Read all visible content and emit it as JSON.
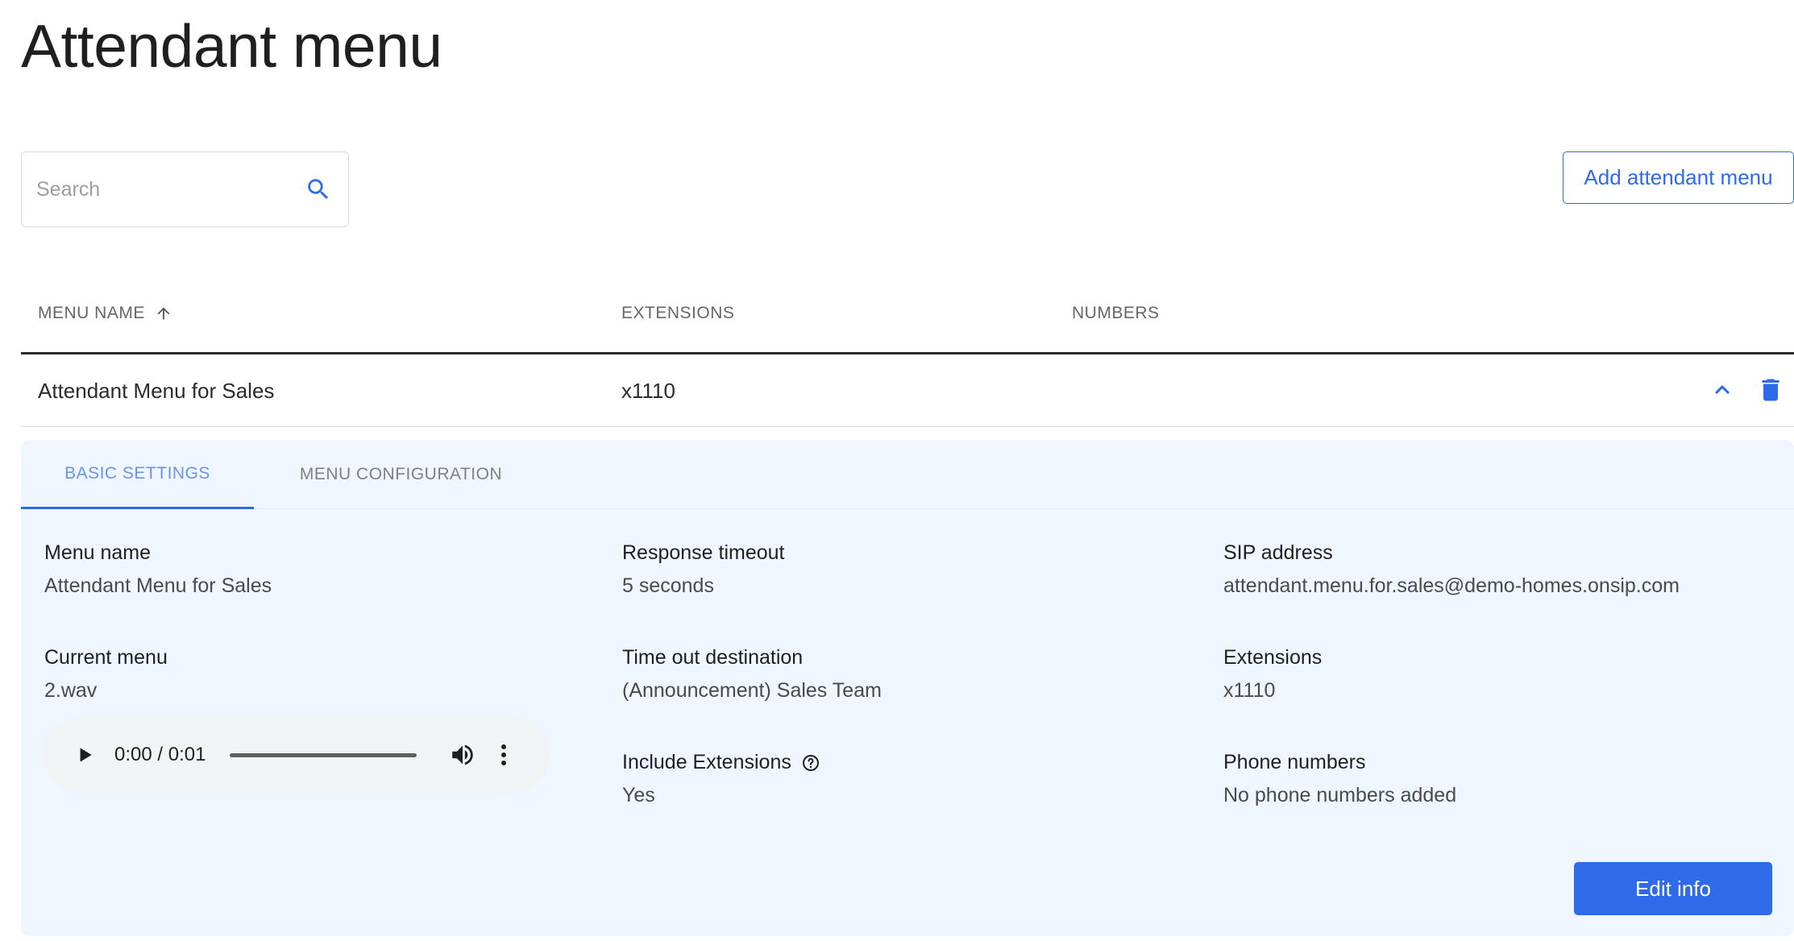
{
  "page": {
    "title": "Attendant menu"
  },
  "search": {
    "placeholder": "Search",
    "value": ""
  },
  "toolbar": {
    "add_label": "Add attendant menu"
  },
  "table": {
    "columns": [
      "MENU NAME",
      "EXTENSIONS",
      "NUMBERS"
    ],
    "sort_column": "MENU NAME",
    "sort_direction": "ascending",
    "rows": [
      {
        "name": "Attendant Menu for Sales",
        "extensions": "x1110",
        "numbers": ""
      }
    ]
  },
  "details": {
    "tabs": [
      {
        "label": "BASIC SETTINGS",
        "active": true
      },
      {
        "label": "MENU CONFIGURATION",
        "active": false
      }
    ],
    "menu_name": {
      "label": "Menu name",
      "value": "Attendant Menu for Sales"
    },
    "current_menu": {
      "label": "Current menu",
      "value": "2.wav"
    },
    "response_timeout": {
      "label": "Response timeout",
      "value": "5 seconds"
    },
    "timeout_destination": {
      "label": "Time out destination",
      "value": "(Announcement) Sales Team"
    },
    "include_extensions": {
      "label": "Include Extensions",
      "value": "Yes"
    },
    "sip_address": {
      "label": "SIP address",
      "value": "attendant.menu.for.sales@demo-homes.onsip.com"
    },
    "extensions": {
      "label": "Extensions",
      "value": "x1110"
    },
    "phone_numbers": {
      "label": "Phone numbers",
      "value": "No phone numbers added"
    },
    "audio": {
      "time": "0:00 / 0:01",
      "progress": 0
    },
    "edit_label": "Edit info"
  },
  "colors": {
    "accent": "#2f6ae8",
    "panel_bg": "#f0f6ff",
    "active_tab_text": "#6b93e8"
  },
  "icons": {
    "search": "search-icon",
    "sort": "arrow-up-icon",
    "collapse": "chevron-up-icon",
    "delete": "trash-icon",
    "help": "help-circle-icon",
    "play": "play-icon",
    "volume": "volume-icon",
    "more": "more-vertical-icon"
  }
}
